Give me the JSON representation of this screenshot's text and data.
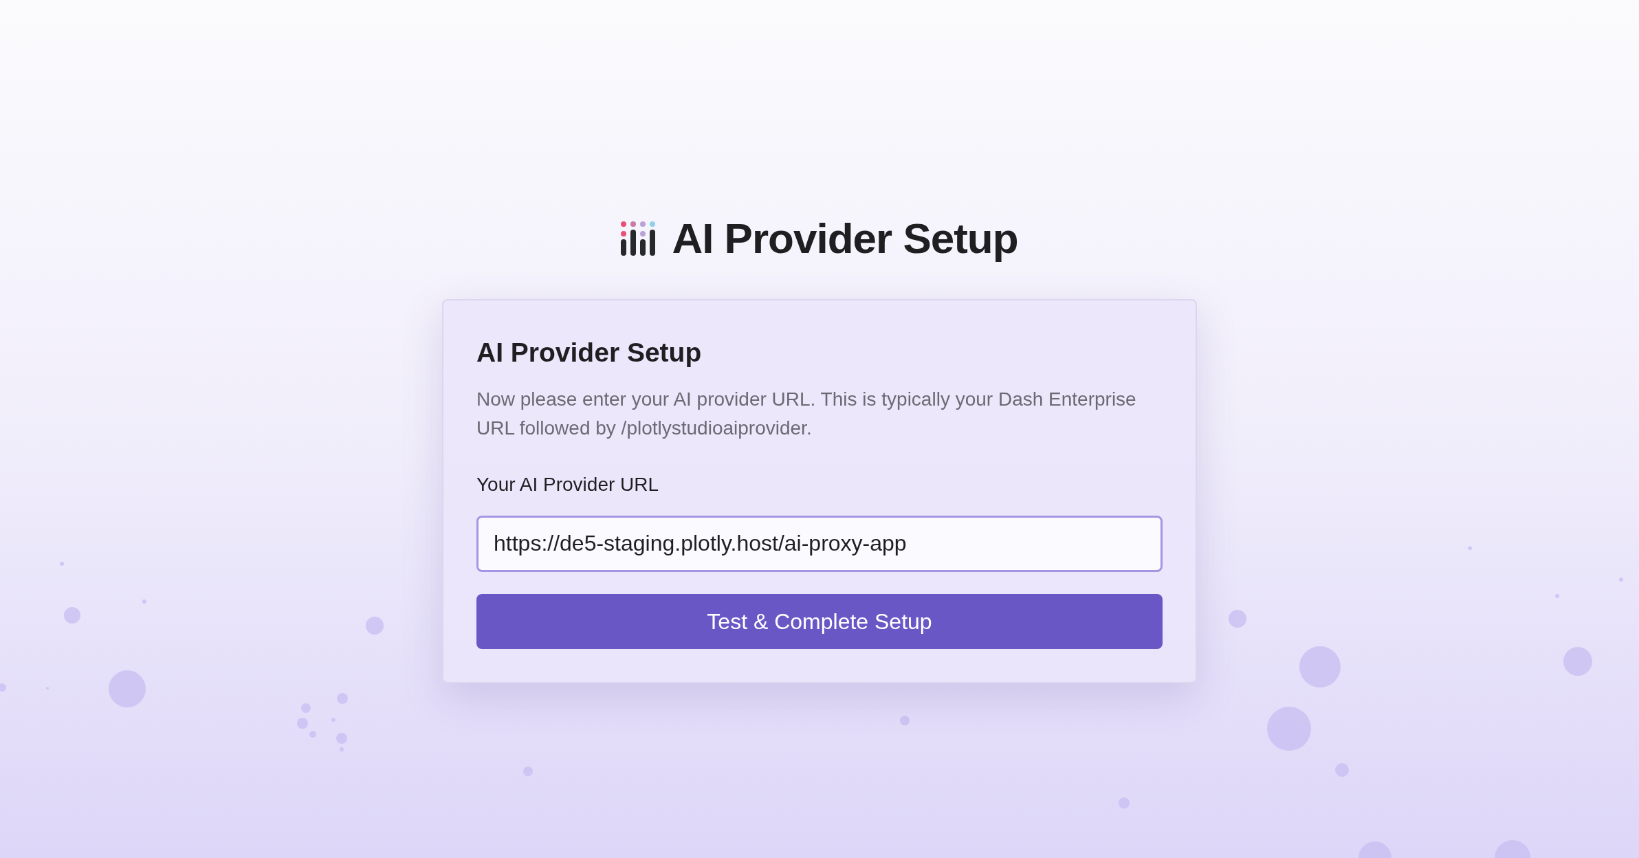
{
  "header": {
    "title": "AI Provider Setup"
  },
  "card": {
    "title": "AI Provider Setup",
    "description": "Now please enter your AI provider URL. This is typically your Dash Enterprise URL followed by /plotlystudioaiprovider.",
    "field": {
      "label": "Your AI Provider URL",
      "value": "https://de5-staging.plotly.host/ai-proxy-app",
      "focused": true
    },
    "button": {
      "label": "Test & Complete Setup"
    }
  }
}
